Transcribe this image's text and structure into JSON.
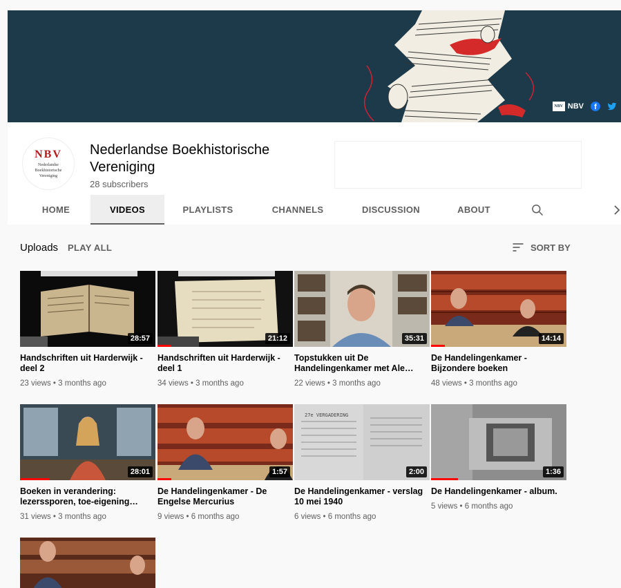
{
  "banner": {
    "link_label": "NBV",
    "nbv_icon_text": "NBV"
  },
  "channel": {
    "avatar_title": "NBV",
    "avatar_sub": [
      "Nederlandse",
      "Boekhistorische",
      "Vereniging"
    ],
    "name": "Nederlandse Boekhistorische Vereniging",
    "subscribers": "28 subscribers"
  },
  "tabs": [
    {
      "label": "HOME"
    },
    {
      "label": "VIDEOS"
    },
    {
      "label": "PLAYLISTS"
    },
    {
      "label": "CHANNELS"
    },
    {
      "label": "DISCUSSION"
    },
    {
      "label": "ABOUT"
    }
  ],
  "section": {
    "title": "Uploads",
    "play_all": "PLAY ALL",
    "sort_by": "SORT BY"
  },
  "videos": [
    {
      "title": "Handschriften uit Harderwijk - deel 2",
      "meta": "23 views • 3 months ago",
      "duration": "28:57",
      "watched": 0
    },
    {
      "title": "Handschriften uit Harderwijk - deel 1",
      "meta": "34 views • 3 months ago",
      "duration": "21:12",
      "watched": 0.1
    },
    {
      "title": "Topstukken uit De Handelingenkamer met Ale…",
      "meta": "22 views • 3 months ago",
      "duration": "35:31",
      "watched": 0
    },
    {
      "title": "De Handelingenkamer - Bijzondere boeken",
      "meta": "48 views • 3 months ago",
      "duration": "14:14",
      "watched": 0.1
    },
    {
      "title": "Boeken in verandering: lezerssporen, toe-eigening…",
      "meta": "31 views • 3 months ago",
      "duration": "28:01",
      "watched": 0.22
    },
    {
      "title": "De Handelingenkamer - De Engelse Mercurius",
      "meta": "9 views • 6 months ago",
      "duration": "1:57",
      "watched": 0.1
    },
    {
      "title": "De Handelingenkamer - verslag 10 mei 1940",
      "meta": "6 views • 6 months ago",
      "duration": "2:00",
      "watched": 0
    },
    {
      "title": "De Handelingenkamer - album.",
      "meta": "5 views • 6 months ago",
      "duration": "1:36",
      "watched": 0.2
    }
  ],
  "colors": {
    "banner_bg": "#1d3a4a",
    "accent_red": "#ff0000",
    "brand_red": "#b31b1b"
  }
}
